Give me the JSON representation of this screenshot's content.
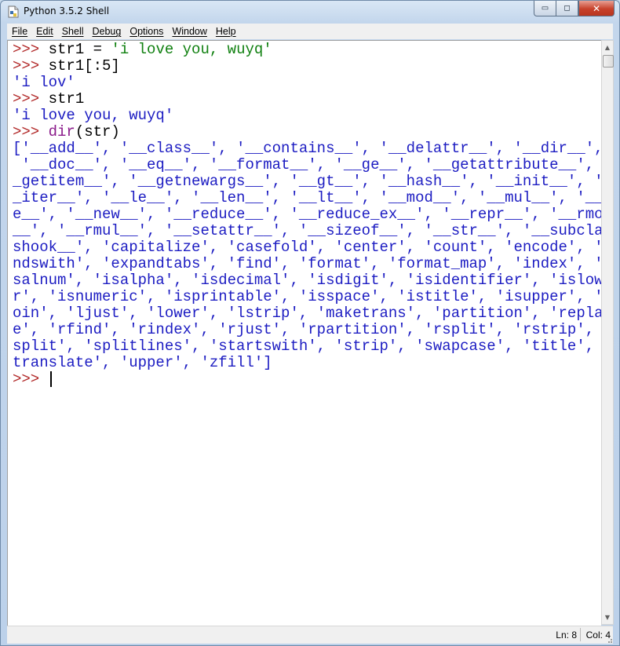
{
  "window": {
    "title": "Python 3.5.2 Shell",
    "controls": {
      "minimize": "▭",
      "maximize": "◻",
      "close": "✕"
    }
  },
  "menubar": {
    "items": [
      "File",
      "Edit",
      "Shell",
      "Debug",
      "Options",
      "Window",
      "Help"
    ]
  },
  "shell": {
    "prompt": ">>> ",
    "line1": {
      "code": "str1 = ",
      "string": "'i love you, wuyq'"
    },
    "line2": {
      "code": "str1[:5]"
    },
    "out2": "'i lov'",
    "line3": {
      "code": "str1"
    },
    "out3": "'i love you, wuyq'",
    "line4": {
      "builtin": "dir",
      "code": "(str)"
    },
    "dir_output": [
      "['__add__', '__class__', '__contains__', '__delattr__', '__dir__',",
      " '__doc__', '__eq__', '__format__', '__ge__', '__getattribute__', '_",
      "_getitem__', '__getnewargs__', '__gt__', '__hash__', '__init__', '_",
      "_iter__', '__le__', '__len__', '__lt__', '__mod__', '__mul__', '__n",
      "e__', '__new__', '__reduce__', '__reduce_ex__', '__repr__', '__rmod",
      "__', '__rmul__', '__setattr__', '__sizeof__', '__str__', '__subclas",
      "shook__', 'capitalize', 'casefold', 'center', 'count', 'encode', 'e",
      "ndswith', 'expandtabs', 'find', 'format', 'format_map', 'index', 'i",
      "salnum', 'isalpha', 'isdecimal', 'isdigit', 'isidentifier', 'islowe",
      "r', 'isnumeric', 'isprintable', 'isspace', 'istitle', 'isupper', 'j",
      "oin', 'ljust', 'lower', 'lstrip', 'maketrans', 'partition', 'replac",
      "e', 'rfind', 'rindex', 'rjust', 'rpartition', 'rsplit', 'rstrip', '",
      "split', 'splitlines', 'startswith', 'strip', 'swapcase', 'title', '",
      "translate', 'upper', 'zfill']"
    ]
  },
  "statusbar": {
    "ln": "Ln: 8",
    "col": "Col: 4"
  },
  "colors": {
    "prompt": "#b22a2a",
    "string": "#108010",
    "output": "#1c1cc2",
    "builtin": "#8a1a8a"
  }
}
